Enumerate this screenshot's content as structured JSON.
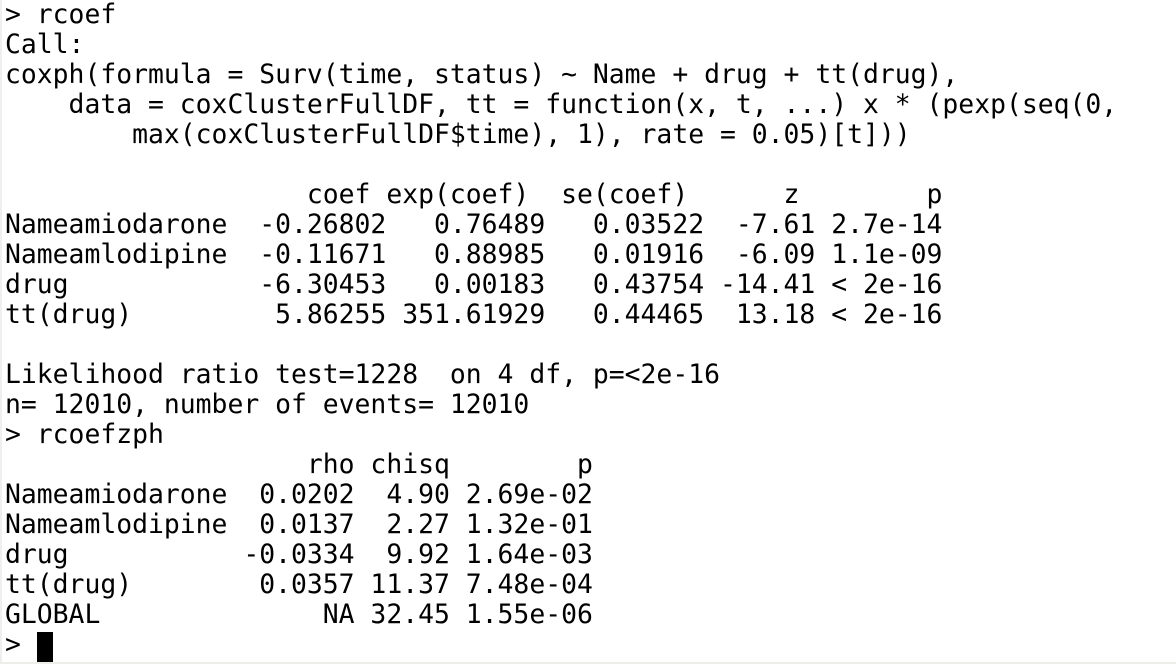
{
  "console": {
    "prompt_symbol": ">",
    "commands": {
      "first": "> rcoef",
      "second": "> rcoefzph",
      "current_prompt": "> "
    },
    "coxph_output": {
      "call_label": "Call:",
      "call_lines": [
        "coxph(formula = Surv(time, status) ~ Name + drug + tt(drug),",
        "    data = coxClusterFullDF, tt = function(x, t, ...) x * (pexp(seq(0,",
        "        max(coxClusterFullDF$time), 1), rate = 0.05)[t]))"
      ],
      "table_header": "                   coef exp(coef)  se(coef)      z        p",
      "table_columns": [
        "",
        "coef",
        "exp(coef)",
        "se(coef)",
        "z",
        "p"
      ],
      "table_rows_text": [
        "Nameamiodarone  -0.26802   0.76489   0.03522  -7.61 2.7e-14",
        "Nameamlodipine  -0.11671   0.88985   0.01916  -6.09 1.1e-09",
        "drug            -6.30453   0.00183   0.43754 -14.41 < 2e-16",
        "tt(drug)         5.86255 351.61929   0.44465  13.18 < 2e-16"
      ],
      "table_rows": [
        {
          "term": "Nameamiodarone",
          "coef": "-0.26802",
          "exp_coef": "0.76489",
          "se_coef": "0.03522",
          "z": "-7.61",
          "p": "2.7e-14"
        },
        {
          "term": "Nameamlodipine",
          "coef": "-0.11671",
          "exp_coef": "0.88985",
          "se_coef": "0.01916",
          "z": "-6.09",
          "p": "1.1e-09"
        },
        {
          "term": "drug",
          "coef": "-6.30453",
          "exp_coef": "0.00183",
          "se_coef": "0.43754",
          "z": "-14.41",
          "p": "< 2e-16"
        },
        {
          "term": "tt(drug)",
          "coef": "5.86255",
          "exp_coef": "351.61929",
          "se_coef": "0.44465",
          "z": "13.18",
          "p": "< 2e-16"
        }
      ],
      "likelihood_line": "Likelihood ratio test=1228  on 4 df, p=<2e-16",
      "n_line": "n= 12010, number of events= 12010"
    },
    "zph_output": {
      "table_header": "                   rho chisq        p",
      "table_columns": [
        "",
        "rho",
        "chisq",
        "p"
      ],
      "table_rows_text": [
        "Nameamiodarone  0.0202  4.90 2.69e-02",
        "Nameamlodipine  0.0137  2.27 1.32e-01",
        "drug           -0.0334  9.92 1.64e-03",
        "tt(drug)        0.0357 11.37 7.48e-04",
        "GLOBAL              NA 32.45 1.55e-06"
      ],
      "table_rows": [
        {
          "term": "Nameamiodarone",
          "rho": "0.0202",
          "chisq": "4.90",
          "p": "2.69e-02"
        },
        {
          "term": "Nameamlodipine",
          "rho": "0.0137",
          "chisq": "2.27",
          "p": "1.32e-01"
        },
        {
          "term": "drug",
          "rho": "-0.0334",
          "chisq": "9.92",
          "p": "1.64e-03"
        },
        {
          "term": "tt(drug)",
          "rho": "0.0357",
          "chisq": "11.37",
          "p": "7.48e-04"
        },
        {
          "term": "GLOBAL",
          "rho": "NA",
          "chisq": "32.45",
          "p": "1.55e-06"
        }
      ]
    },
    "colors": {
      "background": "#ffffff",
      "text": "#000000",
      "cursor": "#000000"
    }
  }
}
